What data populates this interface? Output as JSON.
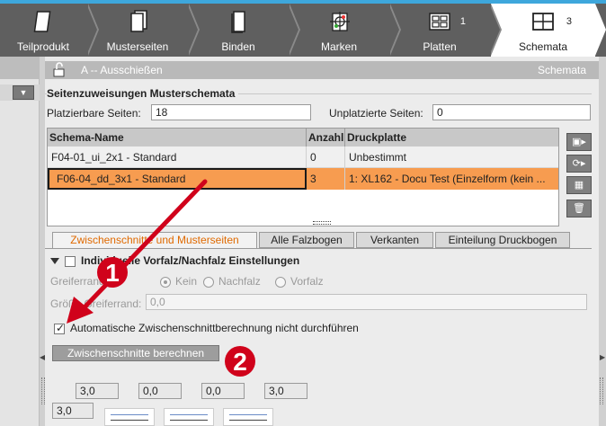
{
  "workflow_tabs": [
    {
      "label": "Teilprodukt",
      "count": ""
    },
    {
      "label": "Musterseiten",
      "count": ""
    },
    {
      "label": "Binden",
      "count": ""
    },
    {
      "label": "Marken",
      "count": ""
    },
    {
      "label": "Platten",
      "count": "1"
    },
    {
      "label": "Schemata",
      "count": "3"
    }
  ],
  "panel": {
    "title": "A -- Ausschießen",
    "right_label": "Schemata"
  },
  "assignments": {
    "section_title": "Seitenzuweisungen Musterschemata",
    "placeable_label": "Platzierbare Seiten:",
    "placeable_value": "18",
    "unplaced_label": "Unplatzierte Seiten:",
    "unplaced_value": "0"
  },
  "table": {
    "columns": [
      "Schema-Name",
      "Anzahl",
      "Druckplatte"
    ],
    "rows": [
      {
        "name": "F04-01_ui_2x1 - Standard",
        "count": "0",
        "plate": "Unbestimmt"
      },
      {
        "name": "F06-04_dd_3x1 - Standard",
        "count": "3",
        "plate": "1: XL162 - Docu Test (Einzelform (kein ..."
      }
    ]
  },
  "tool_buttons": [
    "monitor-icon",
    "rotate-icon",
    "grid-icon",
    "trash-icon"
  ],
  "lower_tabs": [
    "Zwischenschnitte und Musterseiten",
    "Alle Falzbogen",
    "Verkanten",
    "Einteilung Druckbogen"
  ],
  "settings": {
    "title": "Individuelle Vorfalz/Nachfalz Einstellungen",
    "gripper_label": "Greiferrand:",
    "radio_options": [
      "Kein",
      "Nachfalz",
      "Vorfalz"
    ],
    "size_label": "Größe Greiferrand:",
    "size_value": "0,0",
    "auto_checkbox_label": "Automatische Zwischenschnittberechnung nicht durchführen",
    "calc_button": "Zwischenschnitte berechnen"
  },
  "gap_fields": [
    "3,0",
    "0,0",
    "0,0",
    "3,0"
  ],
  "left_gap_field": "3,0",
  "annotations": {
    "marker1": "1",
    "marker2": "2"
  },
  "colors": {
    "accent_orange": "#f79c50",
    "annotation_red": "#d0021b",
    "tab_active_text": "#e06a00"
  }
}
